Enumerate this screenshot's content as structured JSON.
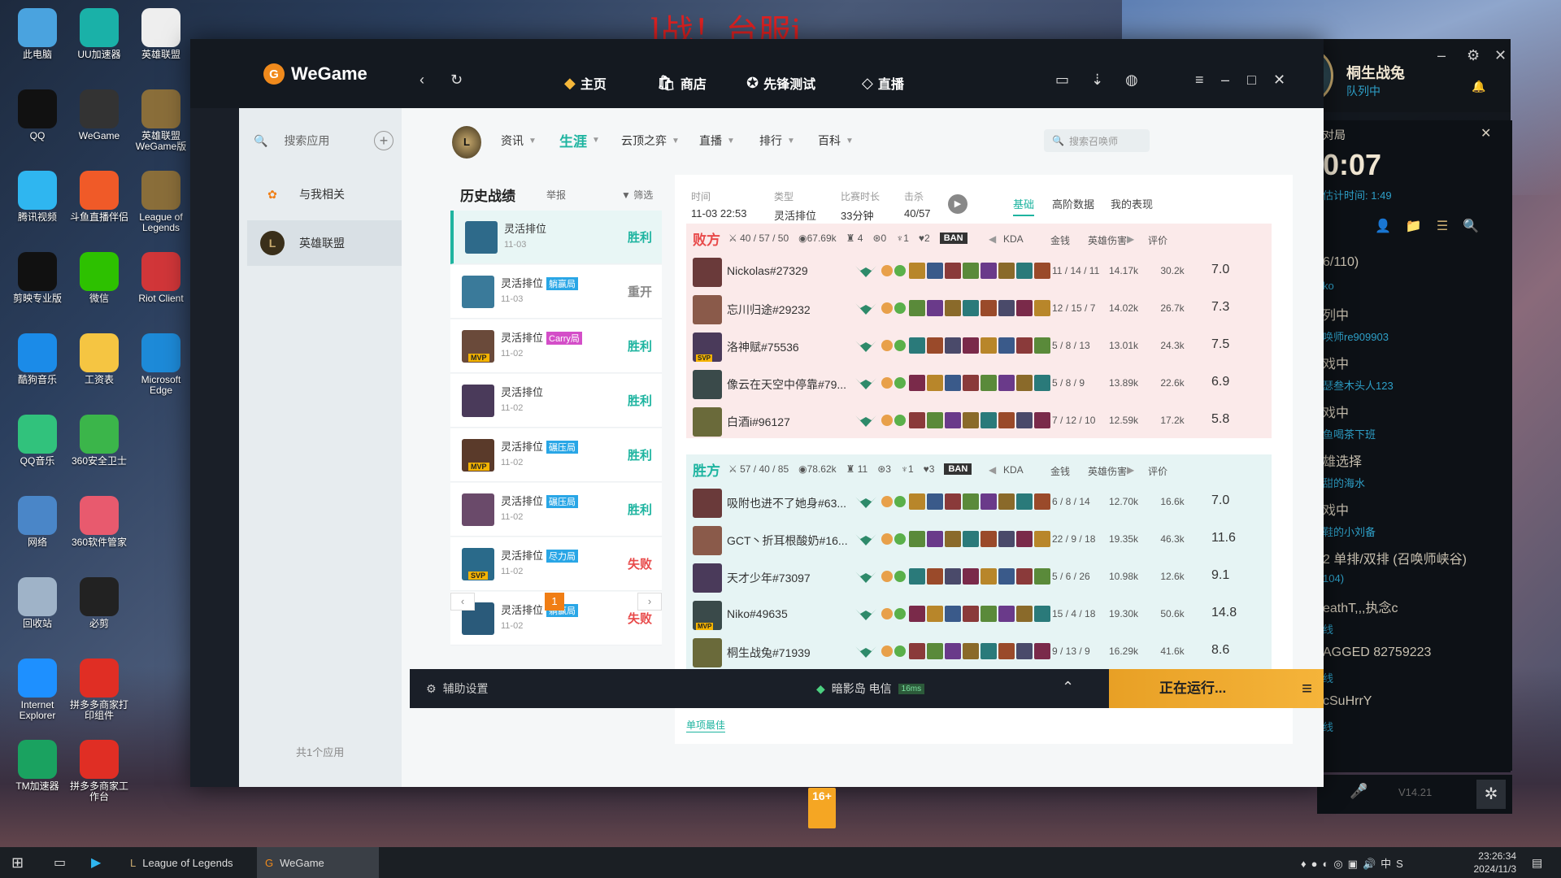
{
  "banner": "l战！台服j",
  "desktop": [
    {
      "label": "此电脑",
      "color": "#4aa3df"
    },
    {
      "label": "UU加速器",
      "color": "#1ab1a8"
    },
    {
      "label": "英雄联盟",
      "color": "#eeeeee"
    },
    {
      "label": "QQ",
      "color": "#111111"
    },
    {
      "label": "WeGame",
      "color": "#333333"
    },
    {
      "label": "英雄联盟WeGame版",
      "color": "#8a6e3a"
    },
    {
      "label": "腾讯视频",
      "color": "#2fb6f0"
    },
    {
      "label": "斗鱼直播伴侣",
      "color": "#f05a28"
    },
    {
      "label": "League of Legends",
      "color": "#8a6e3a"
    },
    {
      "label": "剪映专业版",
      "color": "#111111"
    },
    {
      "label": "微信",
      "color": "#2dc100"
    },
    {
      "label": "Riot Client",
      "color": "#d13639"
    },
    {
      "label": "酷狗音乐",
      "color": "#1b8be8"
    },
    {
      "label": "工资表",
      "color": "#f5c542"
    },
    {
      "label": "Microsoft Edge",
      "color": "#1d8ad8"
    },
    {
      "label": "QQ音乐",
      "color": "#31c27c"
    },
    {
      "label": "360安全卫士",
      "color": "#3bb54a"
    },
    {
      "label": "网络",
      "color": "#4a86c8"
    },
    {
      "label": "360软件管家",
      "color": "#e85a6e"
    },
    {
      "label": "回收站",
      "color": "#9fb3c8"
    },
    {
      "label": "必剪",
      "color": "#222222"
    },
    {
      "label": "Internet Explorer",
      "color": "#1e90ff"
    },
    {
      "label": "拼多多商家打印组件",
      "color": "#e02e24"
    },
    {
      "label": "TM加速器",
      "color": "#1aa260"
    },
    {
      "label": "拼多多商家工作台",
      "color": "#e02e24"
    }
  ],
  "lolclient": {
    "name": "桐生战兔",
    "status": "队列中",
    "queue_label": "对局",
    "timer": "0:07",
    "est_label": "估计时间:",
    "est_time": "1:49",
    "list": [
      "6/110)",
      "ko",
      "列中",
      "唤师re909903",
      "戏中",
      "瑟叁木头人123",
      "戏中",
      "鱼喝茶下班",
      "雄选择",
      "甜的海水",
      "戏中",
      "鞋的小刘备",
      "2 单排/双排 (召唤师峡谷)",
      "104)",
      "eathT,,,执念c",
      "线",
      "AGGED 82759223",
      "线",
      "cSuHrrY",
      "线"
    ],
    "version": "V14.21"
  },
  "wegame": {
    "logo": "WeGame",
    "nav": [
      {
        "label": "主页"
      },
      {
        "label": "商店"
      },
      {
        "label": "先锋测试"
      },
      {
        "label": "直播"
      }
    ],
    "sidebar": {
      "search": "搜索应用",
      "items": [
        {
          "label": "与我相关"
        },
        {
          "label": "英雄联盟"
        }
      ],
      "count": "共1个应用"
    },
    "tabs": [
      {
        "label": "资讯"
      },
      {
        "label": "生涯"
      },
      {
        "label": "云顶之弈"
      },
      {
        "label": "直播"
      },
      {
        "label": "排行"
      },
      {
        "label": "百科"
      }
    ],
    "search_summoner": "搜索召唤师",
    "history": {
      "title": "历史战绩",
      "report": "举报",
      "filter": "筛选",
      "matches": [
        {
          "queue": "灵活排位",
          "tag": "",
          "date": "11-03",
          "result": "胜利",
          "rc": "#1eb4a0"
        },
        {
          "queue": "灵活排位",
          "tag": "躺赢局",
          "date": "11-03",
          "result": "重开",
          "rc": "#888888"
        },
        {
          "queue": "灵活排位",
          "tag": "Carry局",
          "date": "11-02",
          "result": "胜利",
          "rc": "#1eb4a0"
        },
        {
          "queue": "灵活排位",
          "tag": "",
          "date": "11-02",
          "result": "胜利",
          "rc": "#1eb4a0"
        },
        {
          "queue": "灵活排位",
          "tag": "碾压局",
          "date": "11-02",
          "result": "胜利",
          "rc": "#1eb4a0"
        },
        {
          "queue": "灵活排位",
          "tag": "碾压局",
          "date": "11-02",
          "result": "胜利",
          "rc": "#1eb4a0"
        },
        {
          "queue": "灵活排位",
          "tag": "尽力局",
          "date": "11-02",
          "result": "失败",
          "rc": "#e84a4a"
        },
        {
          "queue": "灵活排位",
          "tag": "躺赢局",
          "date": "11-02",
          "result": "失败",
          "rc": "#e84a4a"
        }
      ],
      "page": "1"
    },
    "detail": {
      "time_label": "时间",
      "time": "11-03 22:53",
      "type_label": "类型",
      "type": "灵活排位",
      "dur_label": "比赛时长",
      "dur": "33分钟",
      "kill_label": "击杀",
      "kill": "40/57",
      "tabs": [
        "基础",
        "高阶数据",
        "我的表现"
      ],
      "lose": {
        "res": "败方",
        "kda": "40 / 57 / 50",
        "gold": "67.69k",
        "towers": "4",
        "drag": "0",
        "baron": "1",
        "herald": "2",
        "ban": "BAN",
        "players": [
          {
            "name": "Nickolas#27329",
            "kda": "11 / 14 / 11",
            "gold": "14.17k",
            "dmg": "30.2k",
            "score": "7.0"
          },
          {
            "name": "忘川归途#29232",
            "kda": "12 / 15 / 7",
            "gold": "14.02k",
            "dmg": "26.7k",
            "score": "7.3"
          },
          {
            "name": "洛神赋#75536",
            "kda": "5 / 8 / 13",
            "gold": "13.01k",
            "dmg": "24.3k",
            "score": "7.5"
          },
          {
            "name": "像云在天空中停靠#79...",
            "kda": "5 / 8 / 9",
            "gold": "13.89k",
            "dmg": "22.6k",
            "score": "6.9"
          },
          {
            "name": "白酒i#96127",
            "kda": "7 / 12 / 10",
            "gold": "12.59k",
            "dmg": "17.2k",
            "score": "5.8"
          }
        ]
      },
      "win": {
        "res": "胜方",
        "kda": "57 / 40 / 85",
        "gold": "78.62k",
        "towers": "11",
        "drag": "3",
        "baron": "1",
        "herald": "3",
        "ban": "BAN",
        "players": [
          {
            "name": "吸附也进不了她身#63...",
            "kda": "6 / 8 / 14",
            "gold": "12.70k",
            "dmg": "16.6k",
            "score": "7.0"
          },
          {
            "name": "GCT丶折耳根酸奶#16...",
            "kda": "22 / 9 / 18",
            "gold": "19.35k",
            "dmg": "46.3k",
            "score": "11.6"
          },
          {
            "name": "天才少年#73097",
            "kda": "5 / 6 / 26",
            "gold": "10.98k",
            "dmg": "12.6k",
            "score": "9.1"
          },
          {
            "name": "Niko#49635",
            "kda": "15 / 4 / 18",
            "gold": "19.30k",
            "dmg": "50.6k",
            "score": "14.8"
          },
          {
            "name": "桐生战兔#71939",
            "kda": "9 / 13 / 9",
            "gold": "16.29k",
            "dmg": "41.6k",
            "score": "8.6"
          }
        ]
      },
      "col_kda": "KDA",
      "col_gold": "金钱",
      "col_dmg": "英雄伤害",
      "col_score": "评价",
      "best": "单项最佳"
    },
    "bottom": {
      "assist": "辅助设置",
      "server": "暗影岛 电信",
      "ping": "16ms",
      "running": "正在运行..."
    }
  },
  "age": "16+",
  "taskbar": {
    "items": [
      "League of Legends",
      "WeGame"
    ],
    "time": "23:26:34",
    "date": "2024/11/3"
  }
}
